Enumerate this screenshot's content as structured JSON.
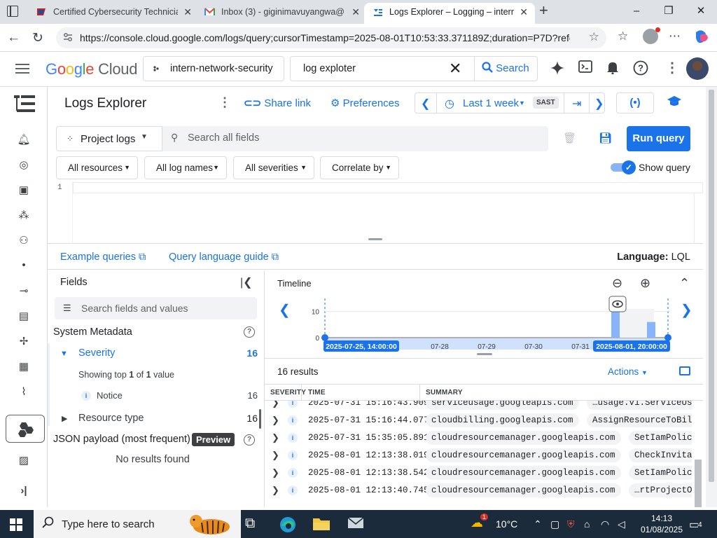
{
  "browser": {
    "tabs": [
      {
        "label": "Certified Cybersecurity Technician",
        "favicon": "ec-council-icon"
      },
      {
        "label": "Inbox (3) - giginimavuyangwa@",
        "favicon": "gmail-icon"
      },
      {
        "label": "Logs Explorer – Logging – intern-",
        "favicon": "logging-icon"
      }
    ],
    "url": "https://console.cloud.google.com/logs/query;cursorTimestamp=2025-08-01T10:53:33.371189Z;duration=P7D?refe..."
  },
  "header": {
    "logo": {
      "google": "Google",
      "cloud": "Cloud"
    },
    "project": "intern-network-security",
    "search_value": "log exploter",
    "search_button": "Search"
  },
  "logs": {
    "title": "Logs Explorer",
    "share_link": "Share link",
    "preferences": "Preferences",
    "time_range": "Last 1 week",
    "timezone": "SAST",
    "project_logs": "Project logs",
    "search_placeholder": "Search all fields",
    "run_query": "Run query",
    "chips": [
      "All resources",
      "All log names",
      "All severities",
      "Correlate by"
    ],
    "show_query": "Show query",
    "line_number": "1",
    "example_queries": "Example queries",
    "query_language_guide": "Query language guide",
    "language_label": "Language:",
    "language_value": "LQL"
  },
  "fields": {
    "title": "Fields",
    "search_placeholder": "Search fields and values",
    "system_metadata": "System Metadata",
    "severity": {
      "label": "Severity",
      "count": "16"
    },
    "showing_top": "Showing top",
    "showing_top_num": "1",
    "showing_of": "of",
    "showing_total": "1",
    "showing_value": "value",
    "notice": {
      "label": "Notice",
      "count": "16"
    },
    "resource_type": {
      "label": "Resource type",
      "count": "16"
    },
    "json_payload": "JSON payload (most frequent)",
    "preview_badge": "Preview",
    "no_results": "No results found"
  },
  "timeline": {
    "title": "Timeline",
    "y_ticks": [
      "10",
      "0"
    ],
    "x_ticks": [
      "07-28",
      "07-29",
      "07-30",
      "07-31"
    ],
    "start_label": "2025-07-25, 14:00:00",
    "end_label": "2025-08-01, 20:00:00"
  },
  "chart_data": {
    "type": "bar",
    "title": "Timeline",
    "xlabel": "",
    "ylabel": "",
    "ylim": [
      0,
      15
    ],
    "categories": [
      "2025-08-01 (first bucket)",
      "2025-08-01 (second bucket)"
    ],
    "values": [
      10,
      6
    ],
    "x_ticks": [
      "07-28",
      "07-29",
      "07-30",
      "07-31"
    ],
    "range": [
      "2025-07-25, 14:00:00",
      "2025-08-01, 20:00:00"
    ]
  },
  "results": {
    "count": "16 results",
    "actions": "Actions",
    "columns": [
      "SEVERITY",
      "TIME",
      "SUMMARY"
    ],
    "rows": [
      {
        "time": "2025-07-31 15:16:43.909",
        "service": "serviceusage.googleapis.com",
        "method": "…usage.v1.ServiceUsage.Enab"
      },
      {
        "time": "2025-07-31 15:16:44.077",
        "service": "cloudbilling.googleapis.com",
        "method": "AssignResourceToBillingAcco"
      },
      {
        "time": "2025-07-31 15:35:05.891",
        "service": "cloudresourcemanager.googleapis.com",
        "method": "SetIamPolicy",
        "extra": "proj"
      },
      {
        "time": "2025-08-01 12:13:38.019",
        "service": "cloudresourcemanager.googleapis.com",
        "method": "CheckInvitationReq"
      },
      {
        "time": "2025-08-01 12:13:38.542",
        "service": "cloudresourcemanager.googleapis.com",
        "method": "SetIamPolicy",
        "extra": "proj"
      },
      {
        "time": "2025-08-01 12:13:40.745",
        "service": "cloudresourcemanager.googleapis.com",
        "method": "…rtProjectOwnershi"
      }
    ]
  },
  "taskbar": {
    "search_placeholder": "Type here to search",
    "temperature": "10°C",
    "time": "14:13",
    "date": "01/08/2025",
    "notifications": "4",
    "weather_badge": "1"
  }
}
